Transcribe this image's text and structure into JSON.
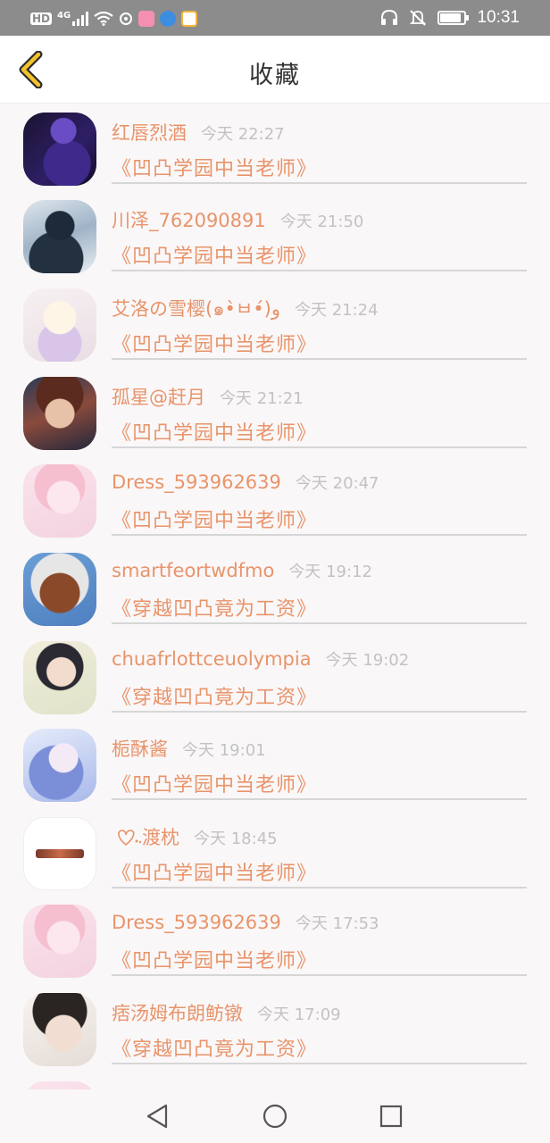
{
  "status_bar": {
    "network_label": "HD",
    "network_type": "4G",
    "time": "10:31",
    "battery_level": 0.8,
    "icons": [
      "signal-icon",
      "wifi-icon",
      "notification-app-icon",
      "headphones-icon",
      "mute-icon",
      "battery-icon"
    ]
  },
  "header": {
    "title": "收藏",
    "back_icon": "chevron-left-icon",
    "accent_color": "#f3c22c"
  },
  "colors": {
    "name": "#e8946a",
    "time": "#c2c2c2",
    "divider": "#d6d6d6",
    "background": "#faf7f8"
  },
  "favorites": [
    {
      "user": "红唇烈酒",
      "time": "今天 22:27",
      "book": "《凹凸学园中当老师》"
    },
    {
      "user": "川泽_762090891",
      "time": "今天 21:50",
      "book": "《凹凸学园中当老师》"
    },
    {
      "user": "艾洛の雪樱(๑•̀ㅂ•́)و",
      "time": "今天 21:24",
      "book": "《凹凸学园中当老师》"
    },
    {
      "user": "孤星@赶月",
      "time": "今天 21:21",
      "book": "《凹凸学园中当老师》"
    },
    {
      "user": "Dress_593962639",
      "time": "今天 20:47",
      "book": "《凹凸学园中当老师》"
    },
    {
      "user": "smartfeortwdfmo",
      "time": "今天 19:12",
      "book": "《穿越凹凸竟为工资》"
    },
    {
      "user": "chuafrlottceuolympia",
      "time": "今天 19:02",
      "book": "《穿越凹凸竟为工资》"
    },
    {
      "user": "栀酥酱",
      "time": "今天 19:01",
      "book": "《凹凸学园中当老师》"
    },
    {
      "user": "渡枕",
      "time": "今天 18:45",
      "book": "《凹凸学园中当老师》"
    },
    {
      "user": "Dress_593962639",
      "time": "今天 17:53",
      "book": "《凹凸学园中当老师》"
    },
    {
      "user": "痞汤姆布朗鲂镦",
      "time": "今天 17:09",
      "book": "《穿越凹凸竟为工资》"
    }
  ],
  "nav": {
    "back_icon": "triangle-back-icon",
    "home_icon": "circle-home-icon",
    "recents_icon": "square-recents-icon"
  }
}
